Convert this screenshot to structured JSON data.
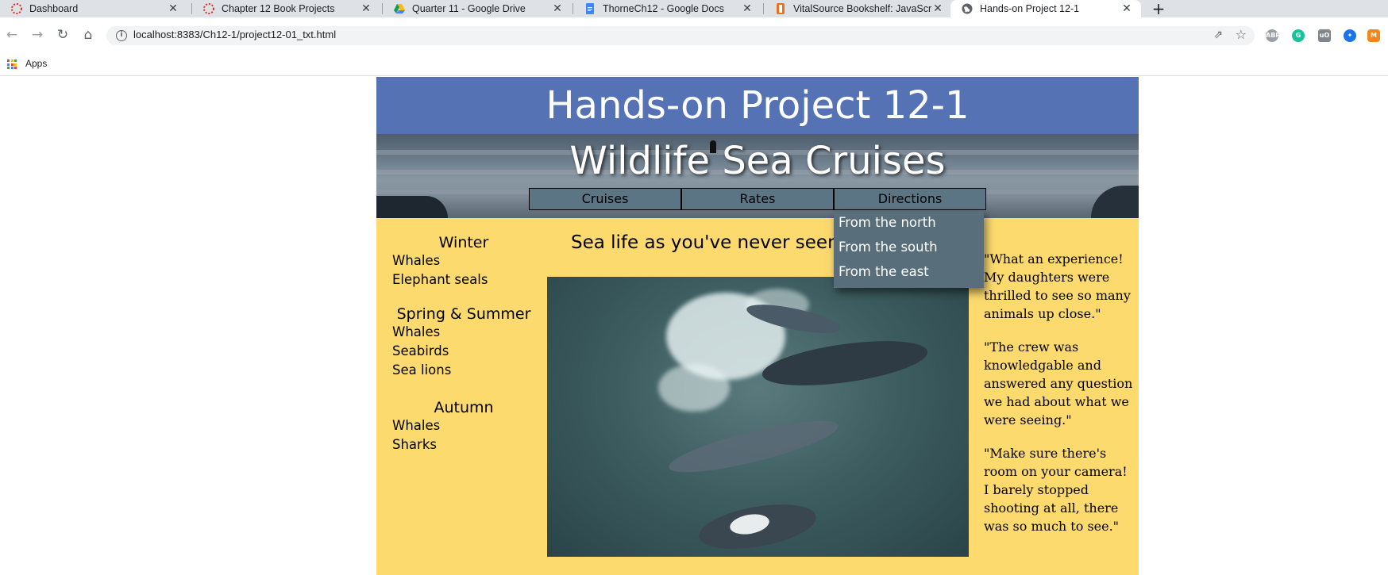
{
  "browser": {
    "tabs": [
      {
        "title": "Dashboard",
        "icon": "loading-ring-icon",
        "active": false
      },
      {
        "title": "Chapter 12 Book Projects",
        "icon": "loading-ring-icon",
        "active": false
      },
      {
        "title": "Quarter 11 - Google Drive",
        "icon": "google-drive-icon",
        "active": false
      },
      {
        "title": "ThorneCh12 - Google Docs",
        "icon": "google-docs-icon",
        "active": false
      },
      {
        "title": "VitalSource Bookshelf: JavaScript",
        "icon": "vitalsource-icon",
        "active": false
      },
      {
        "title": "Hands-on Project 12-1",
        "icon": "globe-icon",
        "active": true
      }
    ],
    "url": "localhost:8383/Ch12-1/project12-01_txt.html",
    "bookmarks": {
      "apps_label": "Apps"
    },
    "extensions": [
      {
        "name": "adblock-plus-icon",
        "label": "ABP",
        "color": "#9aa0a6"
      },
      {
        "name": "grammarly-icon",
        "label": "G",
        "color": "#15c39a"
      },
      {
        "name": "ublock-icon",
        "label": "uO",
        "color": "#80868b"
      },
      {
        "name": "extension-icon",
        "label": "✦",
        "color": "#1a73e8"
      },
      {
        "name": "metamask-icon",
        "label": "M",
        "color": "#f6851b"
      }
    ]
  },
  "page": {
    "banner_title": "Hands-on Project 12-1",
    "site_title": "Wildlife Sea Cruises",
    "nav": [
      "Cruises",
      "Rates",
      "Directions"
    ],
    "directions_menu": [
      "From the north",
      "From the south",
      "From the east"
    ],
    "tagline": "Sea life as you've never seen it",
    "seasons": [
      {
        "name": "Winter",
        "animals": [
          "Whales",
          "Elephant seals"
        ]
      },
      {
        "name": "Spring & Summer",
        "animals": [
          "Whales",
          "Seabirds",
          "Sea lions"
        ]
      },
      {
        "name": "Autumn",
        "animals": [
          "Whales",
          "Sharks"
        ]
      }
    ],
    "testimonials": [
      "\"What an experience! My daughters were thrilled to see so many animals up close.\"",
      "\"The crew was knowledgable and answered any question we had about what we were seeing.\"",
      "\"Make sure there's room on your camera! I barely stopped shooting at all, there was so much to see.\""
    ]
  },
  "colors": {
    "banner": "#5472b4",
    "page_background": "#fcda6e",
    "nav_item": "#5c7584",
    "dropdown": "#586e7a"
  }
}
